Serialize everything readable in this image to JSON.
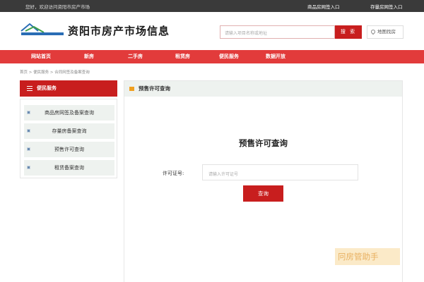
{
  "topbar": {
    "welcome": "您好，欢迎访问资阳市房产市场",
    "link_commercial": "商品房网签入口",
    "link_stock": "存量房网签入口"
  },
  "header": {
    "site_title": "资阳市房产市场信息",
    "search_placeholder": "请输入项目名称或地址",
    "search_button": "搜 索",
    "map_button": "地图找房"
  },
  "nav": {
    "items": [
      {
        "label": "网站首页"
      },
      {
        "label": "新房"
      },
      {
        "label": "二手房"
      },
      {
        "label": "租赁房"
      },
      {
        "label": "便民服务"
      },
      {
        "label": "数据开放"
      }
    ]
  },
  "breadcrumb": "首页 > 便民服务 > 合同网签及备案查询",
  "sidebar": {
    "title": "便民服务",
    "items": [
      {
        "label": "商品房网签及备案查询"
      },
      {
        "label": "存量房备案查询"
      },
      {
        "label": "预售许可查询"
      },
      {
        "label": "租赁备案查询"
      }
    ]
  },
  "main": {
    "panel_title": "预售许可查询",
    "form_title": "预售许可查询",
    "field_label": "许可证号:",
    "field_placeholder": "请输入许可证号",
    "query_button": "查询"
  },
  "watermark": "冋房管助手",
  "colors": {
    "brand_red": "#c81e1e",
    "nav_red": "#e23b3b",
    "topbar_dark": "#3a3a3a",
    "panel_gray": "#eef2ef"
  }
}
